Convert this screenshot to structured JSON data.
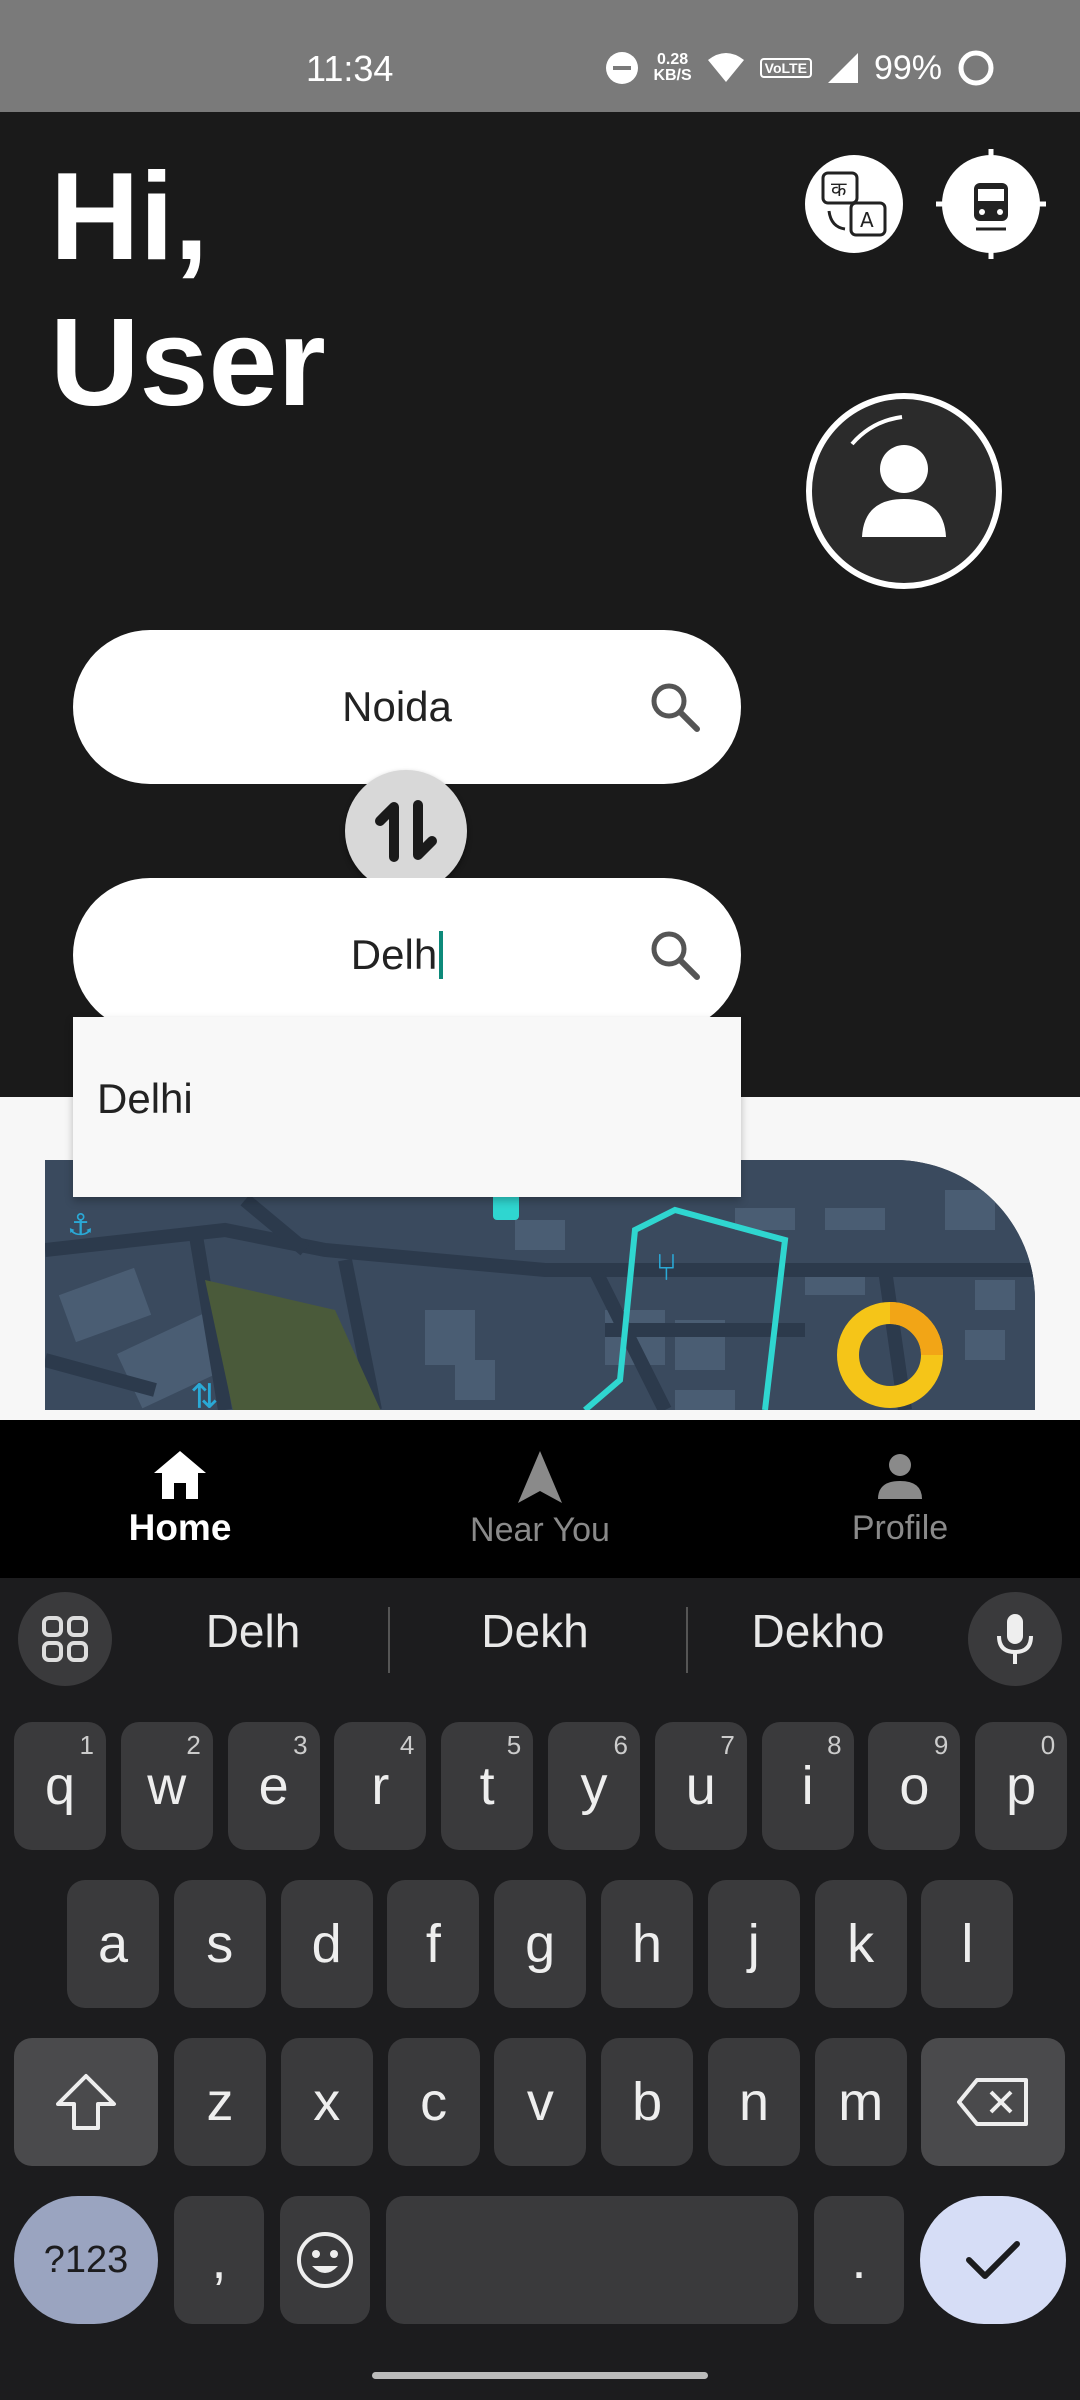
{
  "status_bar": {
    "time": "11:34",
    "net_speed_value": "0.28",
    "net_speed_unit": "KB/S",
    "volte": "VoLTE",
    "battery": "99%"
  },
  "header": {
    "greeting_line1": "Hi,",
    "greeting_line2": "User",
    "translate_icon": "translate-icon",
    "train_icon": "train-locator-icon",
    "avatar_icon": "user-avatar-icon"
  },
  "search": {
    "from_value": "Noida",
    "to_value": "Delh",
    "suggestions": [
      "Delhi"
    ]
  },
  "bottom_nav": {
    "items": [
      {
        "label": "Home",
        "icon": "home-icon",
        "active": true
      },
      {
        "label": "Near You",
        "icon": "navigation-arrow-icon",
        "active": false
      },
      {
        "label": "Profile",
        "icon": "person-icon",
        "active": false
      }
    ]
  },
  "keyboard": {
    "suggestions": [
      "Delh",
      "Dekh",
      "Dekho"
    ],
    "row1": [
      {
        "key": "q",
        "hint": "1"
      },
      {
        "key": "w",
        "hint": "2"
      },
      {
        "key": "e",
        "hint": "3"
      },
      {
        "key": "r",
        "hint": "4"
      },
      {
        "key": "t",
        "hint": "5"
      },
      {
        "key": "y",
        "hint": "6"
      },
      {
        "key": "u",
        "hint": "7"
      },
      {
        "key": "i",
        "hint": "8"
      },
      {
        "key": "o",
        "hint": "9"
      },
      {
        "key": "p",
        "hint": "0"
      }
    ],
    "row2": [
      "a",
      "s",
      "d",
      "f",
      "g",
      "h",
      "j",
      "k",
      "l"
    ],
    "row3": [
      "z",
      "x",
      "c",
      "v",
      "b",
      "n",
      "m"
    ],
    "symbols_key": "?123",
    "comma_key": ",",
    "period_key": "."
  },
  "colors": {
    "header_bg": "#1a1a1a",
    "accent_cursor": "#0d8a7a",
    "map_bg": "#3a4a5e",
    "map_route": "#2fd6d0",
    "map_pin": "#f5c518"
  }
}
